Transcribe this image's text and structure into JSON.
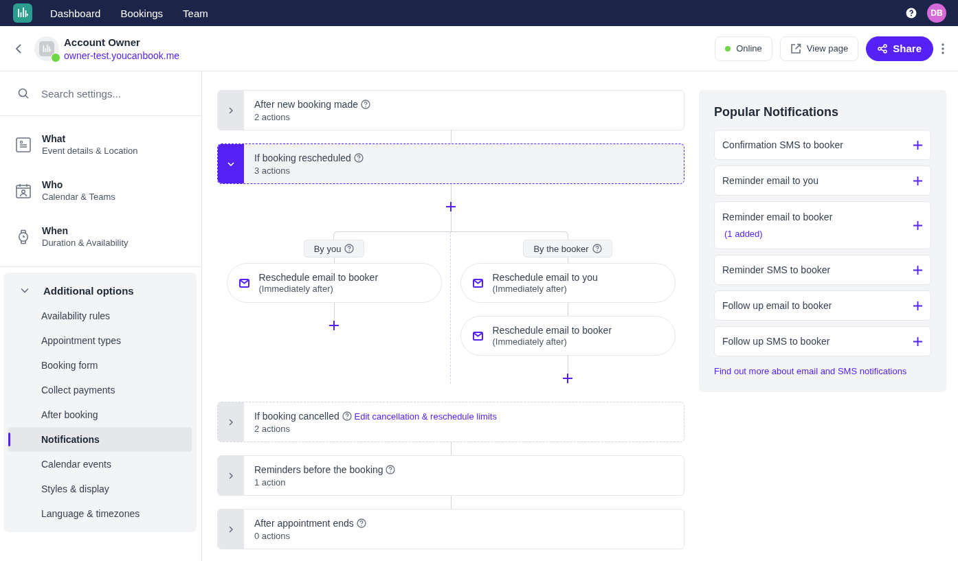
{
  "nav": {
    "items": [
      {
        "label": "Dashboard"
      },
      {
        "label": "Bookings"
      },
      {
        "label": "Team"
      }
    ],
    "avatar_initials": "DB"
  },
  "header": {
    "title": "Account Owner",
    "url": "owner-test.youcanbook.me",
    "status": {
      "label": "Online",
      "online": true
    },
    "view_button": "View page",
    "share_button": "Share"
  },
  "sidebar": {
    "search_placeholder": "Search settings...",
    "sections": [
      {
        "kind": "what",
        "title": "What",
        "subtitle": "Event details & Location"
      },
      {
        "kind": "who",
        "title": "Who",
        "subtitle": "Calendar & Teams"
      },
      {
        "kind": "when",
        "title": "When",
        "subtitle": "Duration & Availability"
      }
    ],
    "group": {
      "title": "Additional options",
      "expanded": true,
      "items": [
        {
          "label": "Availability rules",
          "selected": false
        },
        {
          "label": "Appointment types",
          "selected": false
        },
        {
          "label": "Booking form",
          "selected": false
        },
        {
          "label": "Collect payments",
          "selected": false
        },
        {
          "label": "After booking",
          "selected": false
        },
        {
          "label": "Notifications",
          "selected": true
        },
        {
          "label": "Calendar events",
          "selected": false
        },
        {
          "label": "Styles & display",
          "selected": false
        },
        {
          "label": "Language & timezones",
          "selected": false
        }
      ]
    }
  },
  "triggers": [
    {
      "title": "After new booking made",
      "subtitle": "2 actions",
      "expanded": false,
      "dashed": false
    },
    {
      "title": "If booking rescheduled",
      "subtitle": "3 actions",
      "expanded": true,
      "dashed": true,
      "branches": [
        {
          "label": "By you",
          "actions": [
            {
              "title": "Reschedule email to booker",
              "timing": "(Immediately after)"
            }
          ]
        },
        {
          "label": "By the booker",
          "actions": [
            {
              "title": "Reschedule email to you",
              "timing": "(Immediately after)"
            },
            {
              "title": "Reschedule email to booker",
              "timing": "(Immediately after)"
            }
          ]
        }
      ]
    },
    {
      "title": "If booking cancelled",
      "subtitle": "2 actions",
      "expanded": false,
      "dashed": true,
      "link": "Edit cancellation & reschedule limits"
    },
    {
      "title": "Reminders before the booking",
      "subtitle": "1 action",
      "expanded": false,
      "dashed": false
    },
    {
      "title": "After appointment ends",
      "subtitle": "0 actions",
      "expanded": false,
      "dashed": false
    }
  ],
  "popular": {
    "title": "Popular Notifications",
    "items": [
      {
        "label": "Confirmation SMS to booker"
      },
      {
        "label": "Reminder email to you"
      },
      {
        "label": "Reminder email to booker",
        "note": "(1 added)"
      },
      {
        "label": "Reminder SMS to booker"
      },
      {
        "label": "Follow up email to booker"
      },
      {
        "label": "Follow up SMS to booker"
      }
    ],
    "link": "Find out more about email and SMS notifications"
  }
}
